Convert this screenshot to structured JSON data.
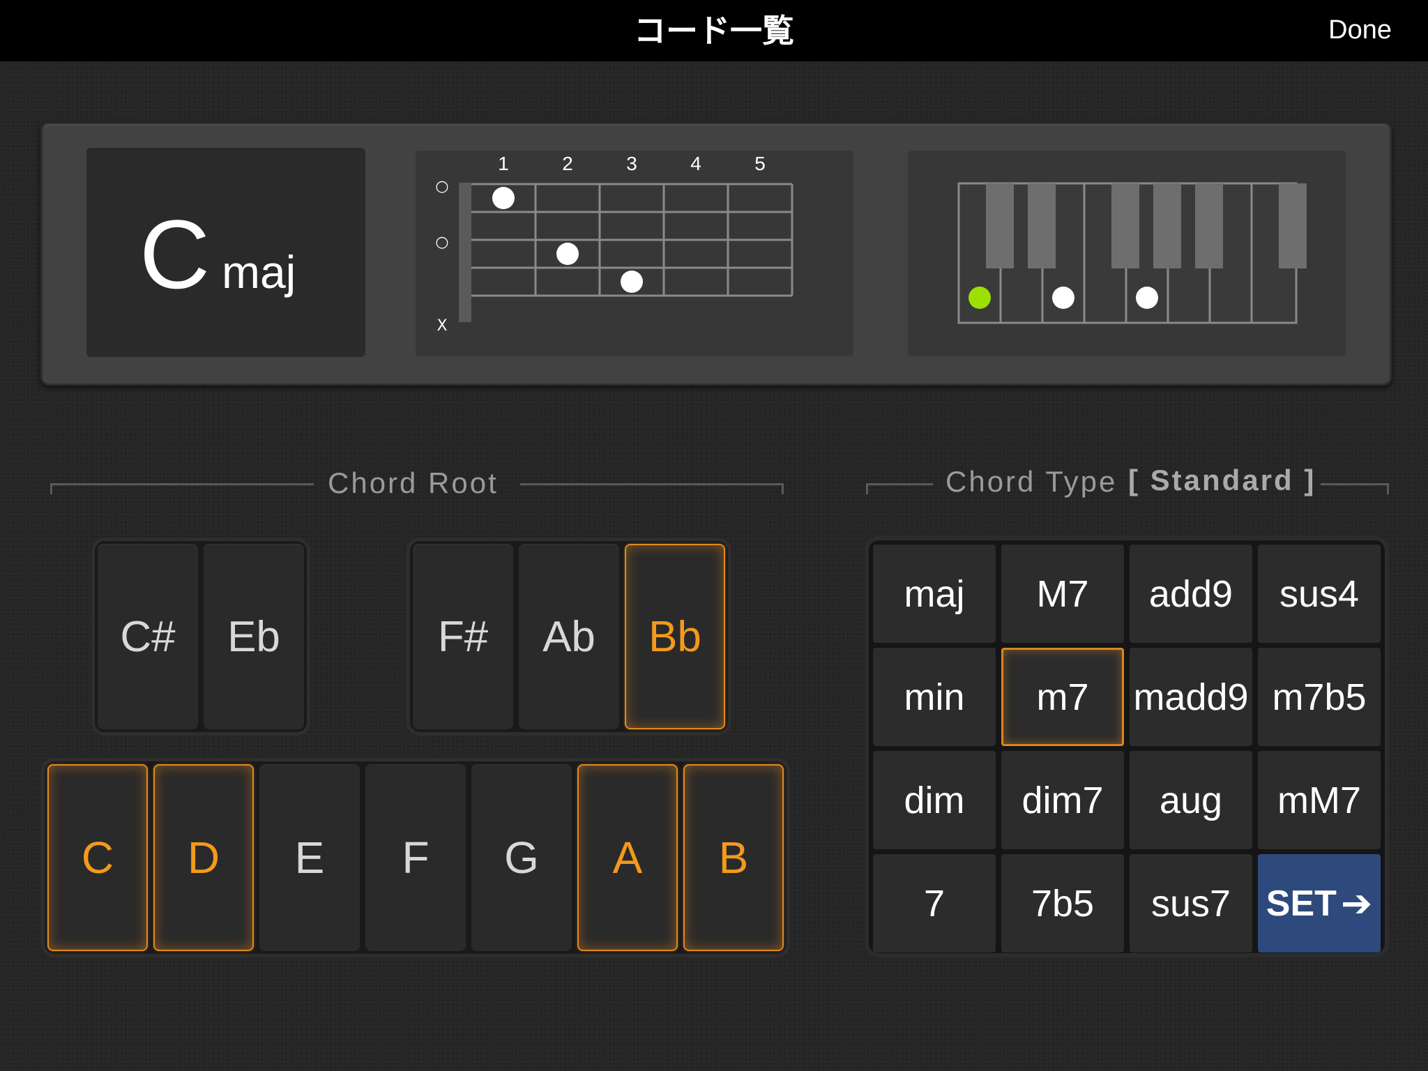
{
  "topbar": {
    "title": "コード一覧",
    "done_label": "Done"
  },
  "display": {
    "root": "C",
    "type": "maj",
    "guitar": {
      "fret_numbers": [
        "1",
        "2",
        "3",
        "4",
        "5"
      ],
      "string_markers": [
        "○",
        "○",
        "X"
      ],
      "dots": [
        {
          "string": 1,
          "fret": 1
        },
        {
          "string": 3,
          "fret": 2
        },
        {
          "string": 4,
          "fret": 3
        }
      ]
    },
    "piano": {
      "root_dot_color": "#9be000",
      "dot_color": "#ffffff"
    }
  },
  "sections": {
    "root_label": "Chord Root",
    "type_label": "Chord Type",
    "type_mode": "[ Standard ]"
  },
  "root_keys": {
    "sharps_left": [
      {
        "label": "C#",
        "selected": false
      },
      {
        "label": "Eb",
        "selected": false
      }
    ],
    "sharps_right": [
      {
        "label": "F#",
        "selected": false
      },
      {
        "label": "Ab",
        "selected": false
      },
      {
        "label": "Bb",
        "selected": true
      }
    ],
    "naturals": [
      {
        "label": "C",
        "selected": true
      },
      {
        "label": "D",
        "selected": true
      },
      {
        "label": "E",
        "selected": false
      },
      {
        "label": "F",
        "selected": false
      },
      {
        "label": "G",
        "selected": false
      },
      {
        "label": "A",
        "selected": true
      },
      {
        "label": "B",
        "selected": true
      }
    ]
  },
  "chord_types": [
    [
      "maj",
      "M7",
      "add9",
      "sus4"
    ],
    [
      "min",
      "m7",
      "madd9",
      "m7b5"
    ],
    [
      "dim",
      "dim7",
      "aug",
      "mM7"
    ],
    [
      "7",
      "7b5",
      "sus7",
      "SET"
    ]
  ],
  "selected_type": "m7",
  "colors": {
    "highlight": "#f39a1c",
    "set_button": "#2e4a7c"
  }
}
